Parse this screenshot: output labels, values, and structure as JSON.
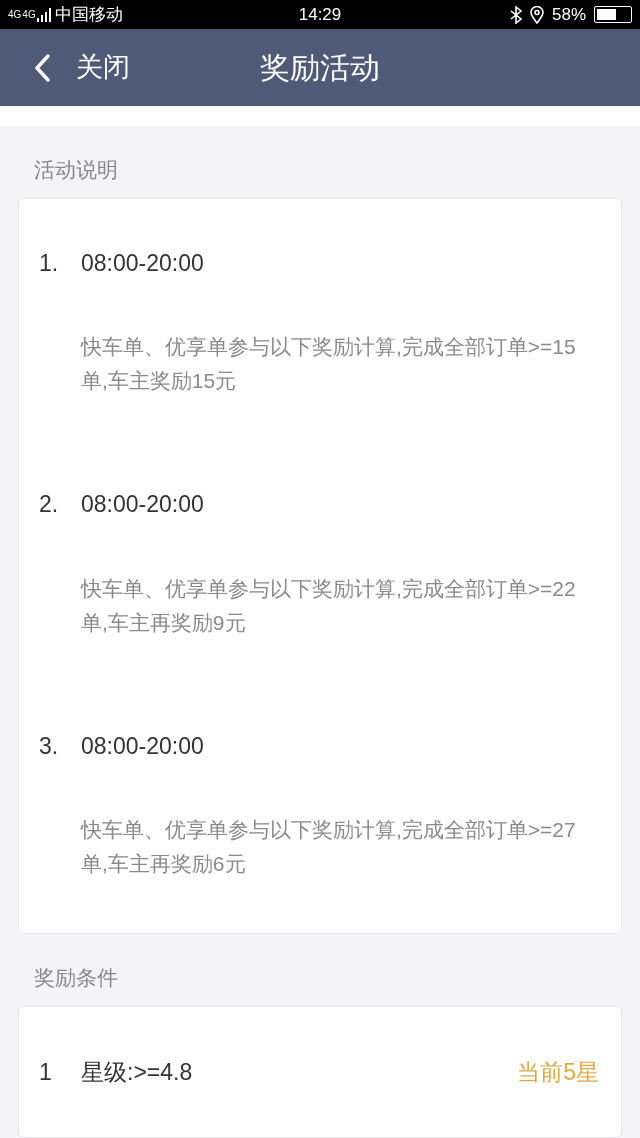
{
  "status_bar": {
    "network": [
      "4G",
      "4G"
    ],
    "carrier": "中国移动",
    "time": "14:29",
    "battery": "58%"
  },
  "header": {
    "back": "关闭",
    "title": "奖励活动"
  },
  "sections": [
    {
      "title": "活动说明",
      "kind": "rules",
      "items": [
        {
          "number": "1.",
          "time": "08:00-20:00",
          "description": "快车单、优享单参与以下奖励计算,完成全部订单>=15单,车主奖励15元"
        },
        {
          "number": "2.",
          "time": "08:00-20:00",
          "description": "快车单、优享单参与以下奖励计算,完成全部订单>=22单,车主再奖励9元"
        },
        {
          "number": "3.",
          "time": "08:00-20:00",
          "description": "快车单、优享单参与以下奖励计算,完成全部订单>=27单,车主再奖励6元"
        }
      ]
    },
    {
      "title": "奖励条件",
      "kind": "conditions",
      "items": [
        {
          "number": "1",
          "condition": "星级:>=4.8",
          "current": "当前5星"
        }
      ]
    }
  ]
}
